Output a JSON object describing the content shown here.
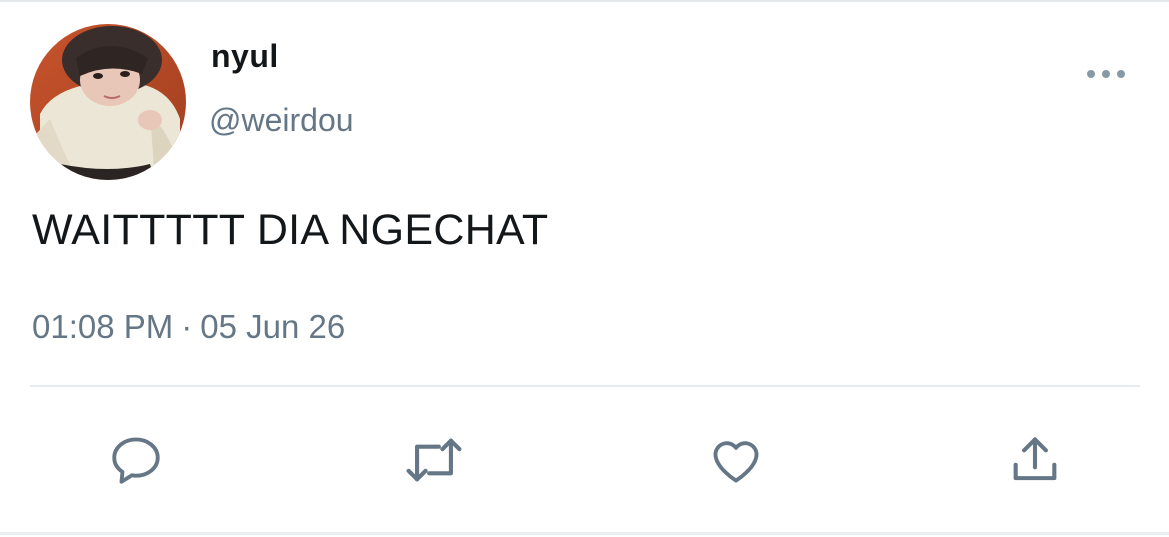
{
  "user": {
    "display_name": "nyul",
    "handle": "@weirdou"
  },
  "tweet": {
    "text": "WAITTTTT DIA NGECHAT",
    "time": "01:08 PM",
    "separator": "·",
    "date": "05 Jun 26"
  },
  "icons": {
    "more": "more-dots-icon",
    "reply": "reply-icon",
    "retweet": "retweet-icon",
    "like": "heart-icon",
    "share": "share-icon"
  },
  "colors": {
    "text_primary": "#14171a",
    "text_secondary": "#657786",
    "divider": "#e6ecf0"
  }
}
